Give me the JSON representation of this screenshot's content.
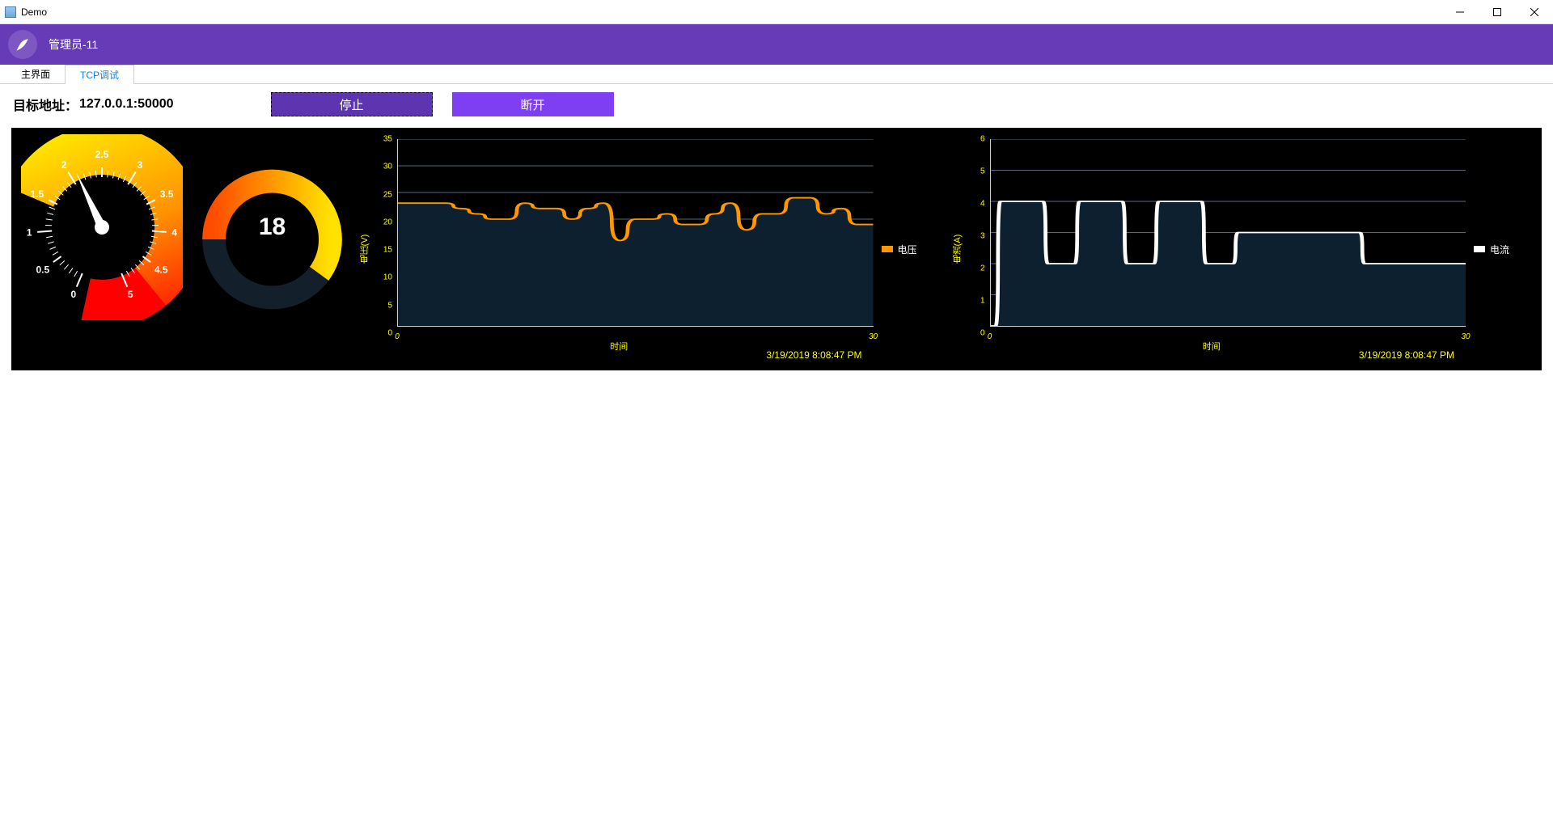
{
  "window": {
    "title": "Demo"
  },
  "header": {
    "user_label": "管理员-11"
  },
  "tabs": {
    "main": "主界面",
    "tcp": "TCP调试",
    "active": "tcp"
  },
  "toolbar": {
    "addr_label": "目标地址：",
    "addr_value": "127.0.0.1:50000",
    "stop_label": "停止",
    "disconnect_label": "断开"
  },
  "gauge": {
    "min": 0,
    "max": 5,
    "value": 2.1,
    "ticks": [
      "0",
      "0.5",
      "1",
      "1.5",
      "2",
      "2.5",
      "3",
      "3.5",
      "4",
      "4.5",
      "5"
    ],
    "warn_from": 4
  },
  "ring": {
    "value": "18",
    "percent": 0.6
  },
  "voltage_chart": {
    "ylabel": "电压(V)",
    "xlabel": "时间",
    "legend": "电压",
    "legend_color": "#ff9800",
    "timestamp": "3/19/2019 8:08:47 PM",
    "yticks": [
      "0",
      "5",
      "10",
      "15",
      "20",
      "25",
      "30",
      "35"
    ],
    "xticks": [
      "0",
      "30"
    ]
  },
  "current_chart": {
    "ylabel": "电流(A)",
    "xlabel": "时间",
    "legend": "电流",
    "legend_color": "#ffffff",
    "timestamp": "3/19/2019 8:08:47 PM",
    "yticks": [
      "0",
      "1",
      "2",
      "3",
      "4",
      "5",
      "6"
    ],
    "xticks": [
      "0",
      "30"
    ]
  },
  "chart_data": [
    {
      "type": "area",
      "title": "电压",
      "xlabel": "时间",
      "ylabel": "电压(V)",
      "xlim": [
        0,
        30
      ],
      "ylim": [
        0,
        35
      ],
      "series": [
        {
          "name": "电压",
          "x": [
            0,
            1,
            2,
            3,
            4,
            5,
            6,
            7,
            8,
            9,
            10,
            11,
            12,
            13,
            14,
            15,
            16,
            17,
            18,
            19,
            20,
            21,
            22,
            23,
            24,
            25,
            26,
            27,
            28,
            29,
            30
          ],
          "y": [
            23,
            23,
            23,
            23,
            22,
            21,
            20,
            20,
            23,
            22,
            22,
            20,
            22,
            23,
            16,
            20,
            20,
            21,
            19,
            19,
            21,
            23,
            18,
            21,
            21,
            24,
            24,
            21,
            22,
            19,
            19
          ]
        }
      ]
    },
    {
      "type": "area",
      "title": "电流",
      "xlabel": "时间",
      "ylabel": "电流(A)",
      "xlim": [
        0,
        30
      ],
      "ylim": [
        0,
        6
      ],
      "series": [
        {
          "name": "电流",
          "x": [
            0,
            1,
            2,
            3,
            4,
            5,
            6,
            7,
            8,
            9,
            10,
            11,
            12,
            13,
            14,
            15,
            16,
            17,
            18,
            19,
            20,
            21,
            22,
            23,
            24,
            25,
            26,
            27,
            28,
            29,
            30
          ],
          "y": [
            0,
            4,
            4,
            4,
            2,
            2,
            4,
            4,
            4,
            2,
            2,
            4,
            4,
            4,
            2,
            2,
            3,
            3,
            3,
            3,
            3,
            3,
            3,
            3,
            2,
            2,
            2,
            2,
            2,
            2,
            2
          ]
        }
      ]
    }
  ]
}
